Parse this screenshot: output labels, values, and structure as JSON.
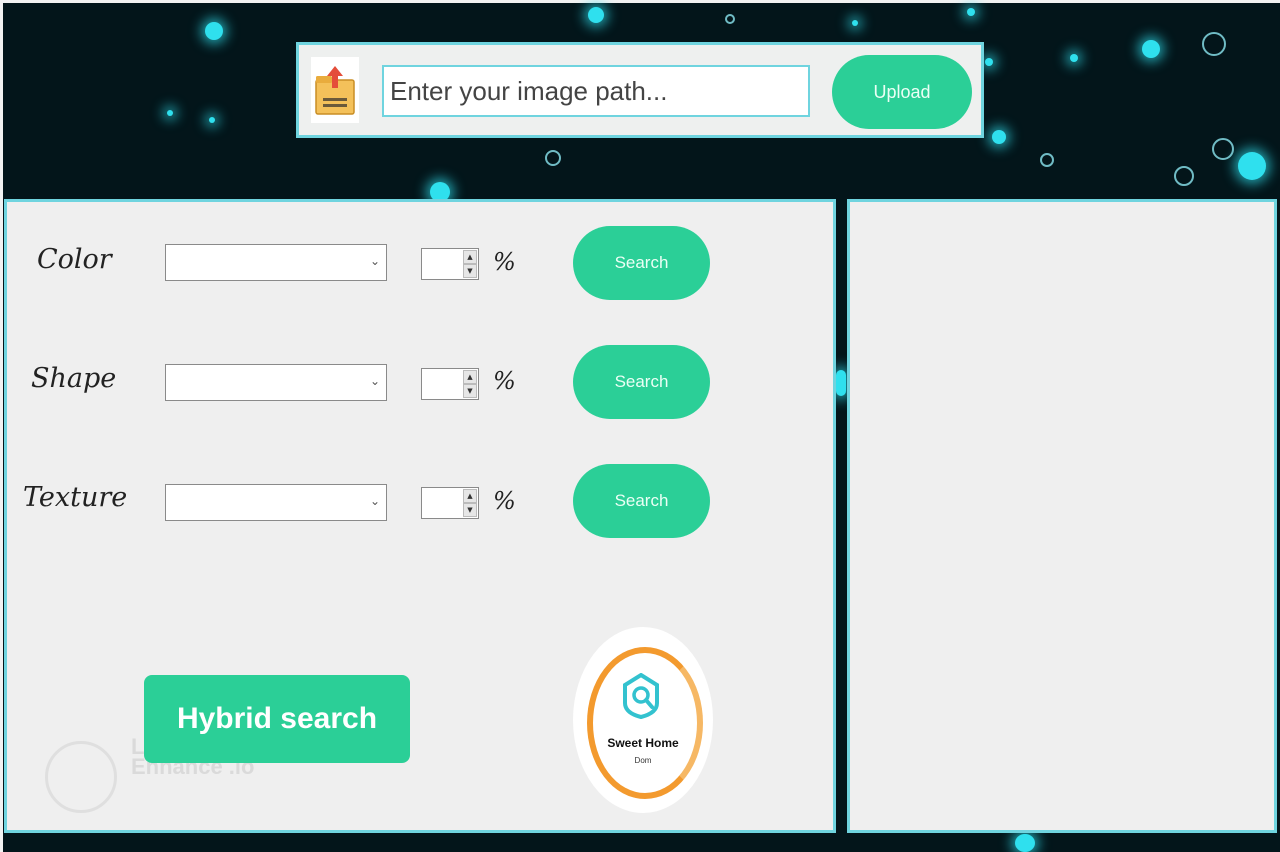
{
  "upload": {
    "placeholder": "Enter your image path...",
    "button_label": "Upload",
    "icon": "folder-upload-icon"
  },
  "filters": [
    {
      "label": "Color",
      "unit": "%",
      "button": "Search"
    },
    {
      "label": "Shape",
      "unit": "%",
      "button": "Search"
    },
    {
      "label": "Texture",
      "unit": "%",
      "button": "Search"
    }
  ],
  "hybrid_button": "Hybrid search",
  "logo": {
    "title": "Sweet Home",
    "subtitle": "Dom"
  },
  "watermark": "Let's Enhance .io",
  "colors": {
    "accent": "#2bcf97",
    "panel_border": "#6fd4df",
    "panel_bg": "#efefef",
    "background": "#03151a",
    "logo_ring": "#f39a2e"
  }
}
